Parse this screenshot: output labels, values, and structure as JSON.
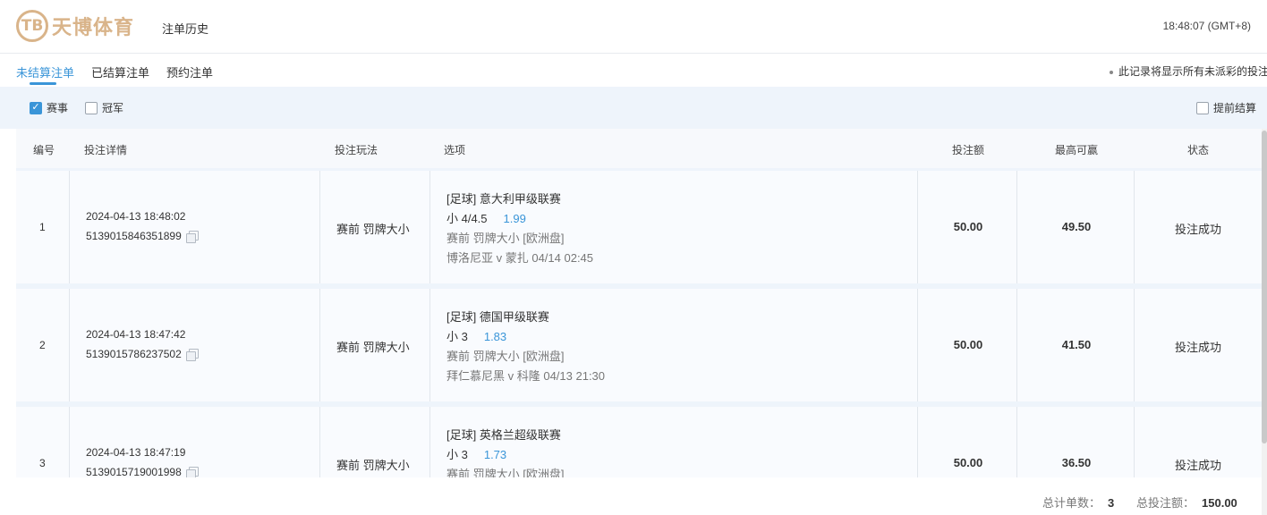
{
  "header": {
    "logo_mark": "TB",
    "logo_text": "天博体育",
    "title": "注单历史",
    "clock": "18:48:07 (GMT+8)"
  },
  "tabs": [
    {
      "label": "未结算注单",
      "active": true
    },
    {
      "label": "已结算注单",
      "active": false
    },
    {
      "label": "预约注单",
      "active": false
    }
  ],
  "notice": "此记录将显示所有未派彩的投注",
  "filters": {
    "events": {
      "label": "赛事",
      "checked": true
    },
    "champion": {
      "label": "冠军",
      "checked": false
    },
    "early_settle": {
      "label": "提前结算",
      "checked": false
    }
  },
  "columns": {
    "no": "编号",
    "details": "投注详情",
    "bet_type": "投注玩法",
    "selection": "选项",
    "stake": "投注额",
    "max_win": "最高可赢",
    "status": "状态"
  },
  "bets": [
    {
      "no": "1",
      "time": "2024-04-13 18:48:02",
      "id": "5139015846351899",
      "bet_type": "赛前   罚牌大小",
      "league": "[足球] 意大利甲级联赛",
      "pick": "小 4/4.5",
      "odds": "1.99",
      "market": "赛前  罚牌大小  [欧洲盘]",
      "match": "博洛尼亚 v 蒙扎    04/14 02:45",
      "stake": "50.00",
      "max_win": "49.50",
      "status": "投注成功"
    },
    {
      "no": "2",
      "time": "2024-04-13 18:47:42",
      "id": "5139015786237502",
      "bet_type": "赛前   罚牌大小",
      "league": "[足球] 德国甲级联赛",
      "pick": "小 3",
      "odds": "1.83",
      "market": "赛前  罚牌大小  [欧洲盘]",
      "match": "拜仁慕尼黑 v 科隆    04/13 21:30",
      "stake": "50.00",
      "max_win": "41.50",
      "status": "投注成功"
    },
    {
      "no": "3",
      "time": "2024-04-13 18:47:19",
      "id": "5139015719001998",
      "bet_type": "赛前   罚牌大小",
      "league": "[足球] 英格兰超级联赛",
      "pick": "小 3",
      "odds": "1.73",
      "market": "赛前  罚牌大小  [欧洲盘]",
      "match": "",
      "stake": "50.00",
      "max_win": "36.50",
      "status": "投注成功"
    }
  ],
  "summary": {
    "count_label": "总计单数：",
    "count": "3",
    "total_label": "总投注额：",
    "total": "150.00"
  }
}
